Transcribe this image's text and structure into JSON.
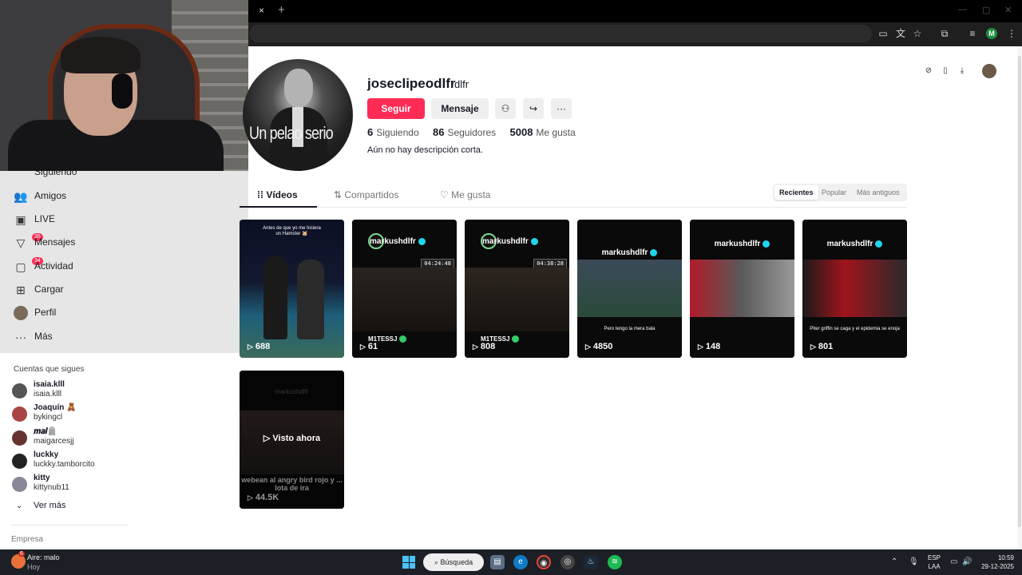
{
  "browser": {
    "close_tab": "×",
    "new_tab": "+",
    "profile_initial": "M"
  },
  "sidebar": {
    "items": [
      {
        "label": "Siguiendo",
        "icon": "following-icon"
      },
      {
        "label": "Amigos",
        "icon": "friends-icon"
      },
      {
        "label": "LIVE",
        "icon": "live-icon"
      },
      {
        "label": "Mensajes",
        "icon": "messages-icon",
        "badge": "35"
      },
      {
        "label": "Actividad",
        "icon": "activity-icon",
        "badge": "34"
      },
      {
        "label": "Cargar",
        "icon": "upload-icon"
      },
      {
        "label": "Perfil",
        "icon": "profile-avatar"
      },
      {
        "label": "Más",
        "icon": "more-icon"
      }
    ]
  },
  "following": {
    "title": "Cuentas que sigues",
    "accounts": [
      {
        "name": "isaia.klll",
        "username": "isaia.klll"
      },
      {
        "name": "Joaquín 🧸",
        "username": "bykingcl"
      },
      {
        "name": "𝒎𝒂𝒊🪦",
        "username": "maigarcesjj"
      },
      {
        "name": "luckky",
        "username": "luckky.tamborcito"
      },
      {
        "name": "kitty",
        "username": "kittynub11"
      }
    ],
    "see_more": "Ver más",
    "footer": "Empresa"
  },
  "profile": {
    "avatar_caption": "Un pelao serio",
    "username": "joseclipeodlfr",
    "nickname": "dlfr",
    "follow_label": "Seguir",
    "message_label": "Mensaje",
    "following_count": "6",
    "following_label": "Siguiendo",
    "followers_count": "86",
    "followers_label": "Seguidores",
    "likes_count": "5008",
    "likes_label": "Me gusta",
    "bio": "Aún no hay descripción corta."
  },
  "tabs": {
    "videos": "Vídeos",
    "shared": "Compartidos",
    "liked": "Me gusta"
  },
  "sort": {
    "recent": "Recientes",
    "popular": "Popular",
    "oldest": "Más antiguos"
  },
  "videos": [
    {
      "views": "688",
      "header": "Antes de que yo me hiciera\nun Hamster 🐹"
    },
    {
      "views": "61",
      "header": "markushdlfr",
      "timer": "04:24:48",
      "tag": "M1TESSJ"
    },
    {
      "views": "808",
      "header": "markushdlfr",
      "timer": "04:38:28",
      "tag": "M1TESSJ"
    },
    {
      "views": "4850",
      "header": "markushdlfr",
      "subtitle": "Pero tengo la mera bala"
    },
    {
      "views": "148",
      "header": "markushdlfr"
    },
    {
      "views": "801",
      "header": "markushdlfr",
      "subtitle": "Piter griffin se caga y el epidemia se enoja"
    },
    {
      "views": "44.5K",
      "watched": "Visto ahora",
      "header": "markushdlfr",
      "caption": "webean al angry bird rojo y ... lota de ira"
    }
  ],
  "taskbar": {
    "weather_badge": "6",
    "weather_title": "Aire: malo",
    "weather_sub": "Hoy",
    "search": "Búsqueda",
    "lang": "ESP",
    "layout": "LAA",
    "time": "10:59",
    "date": "29-12-2025"
  },
  "colors": {
    "accent": "#fe2c55",
    "verified": "#20d5ec"
  }
}
